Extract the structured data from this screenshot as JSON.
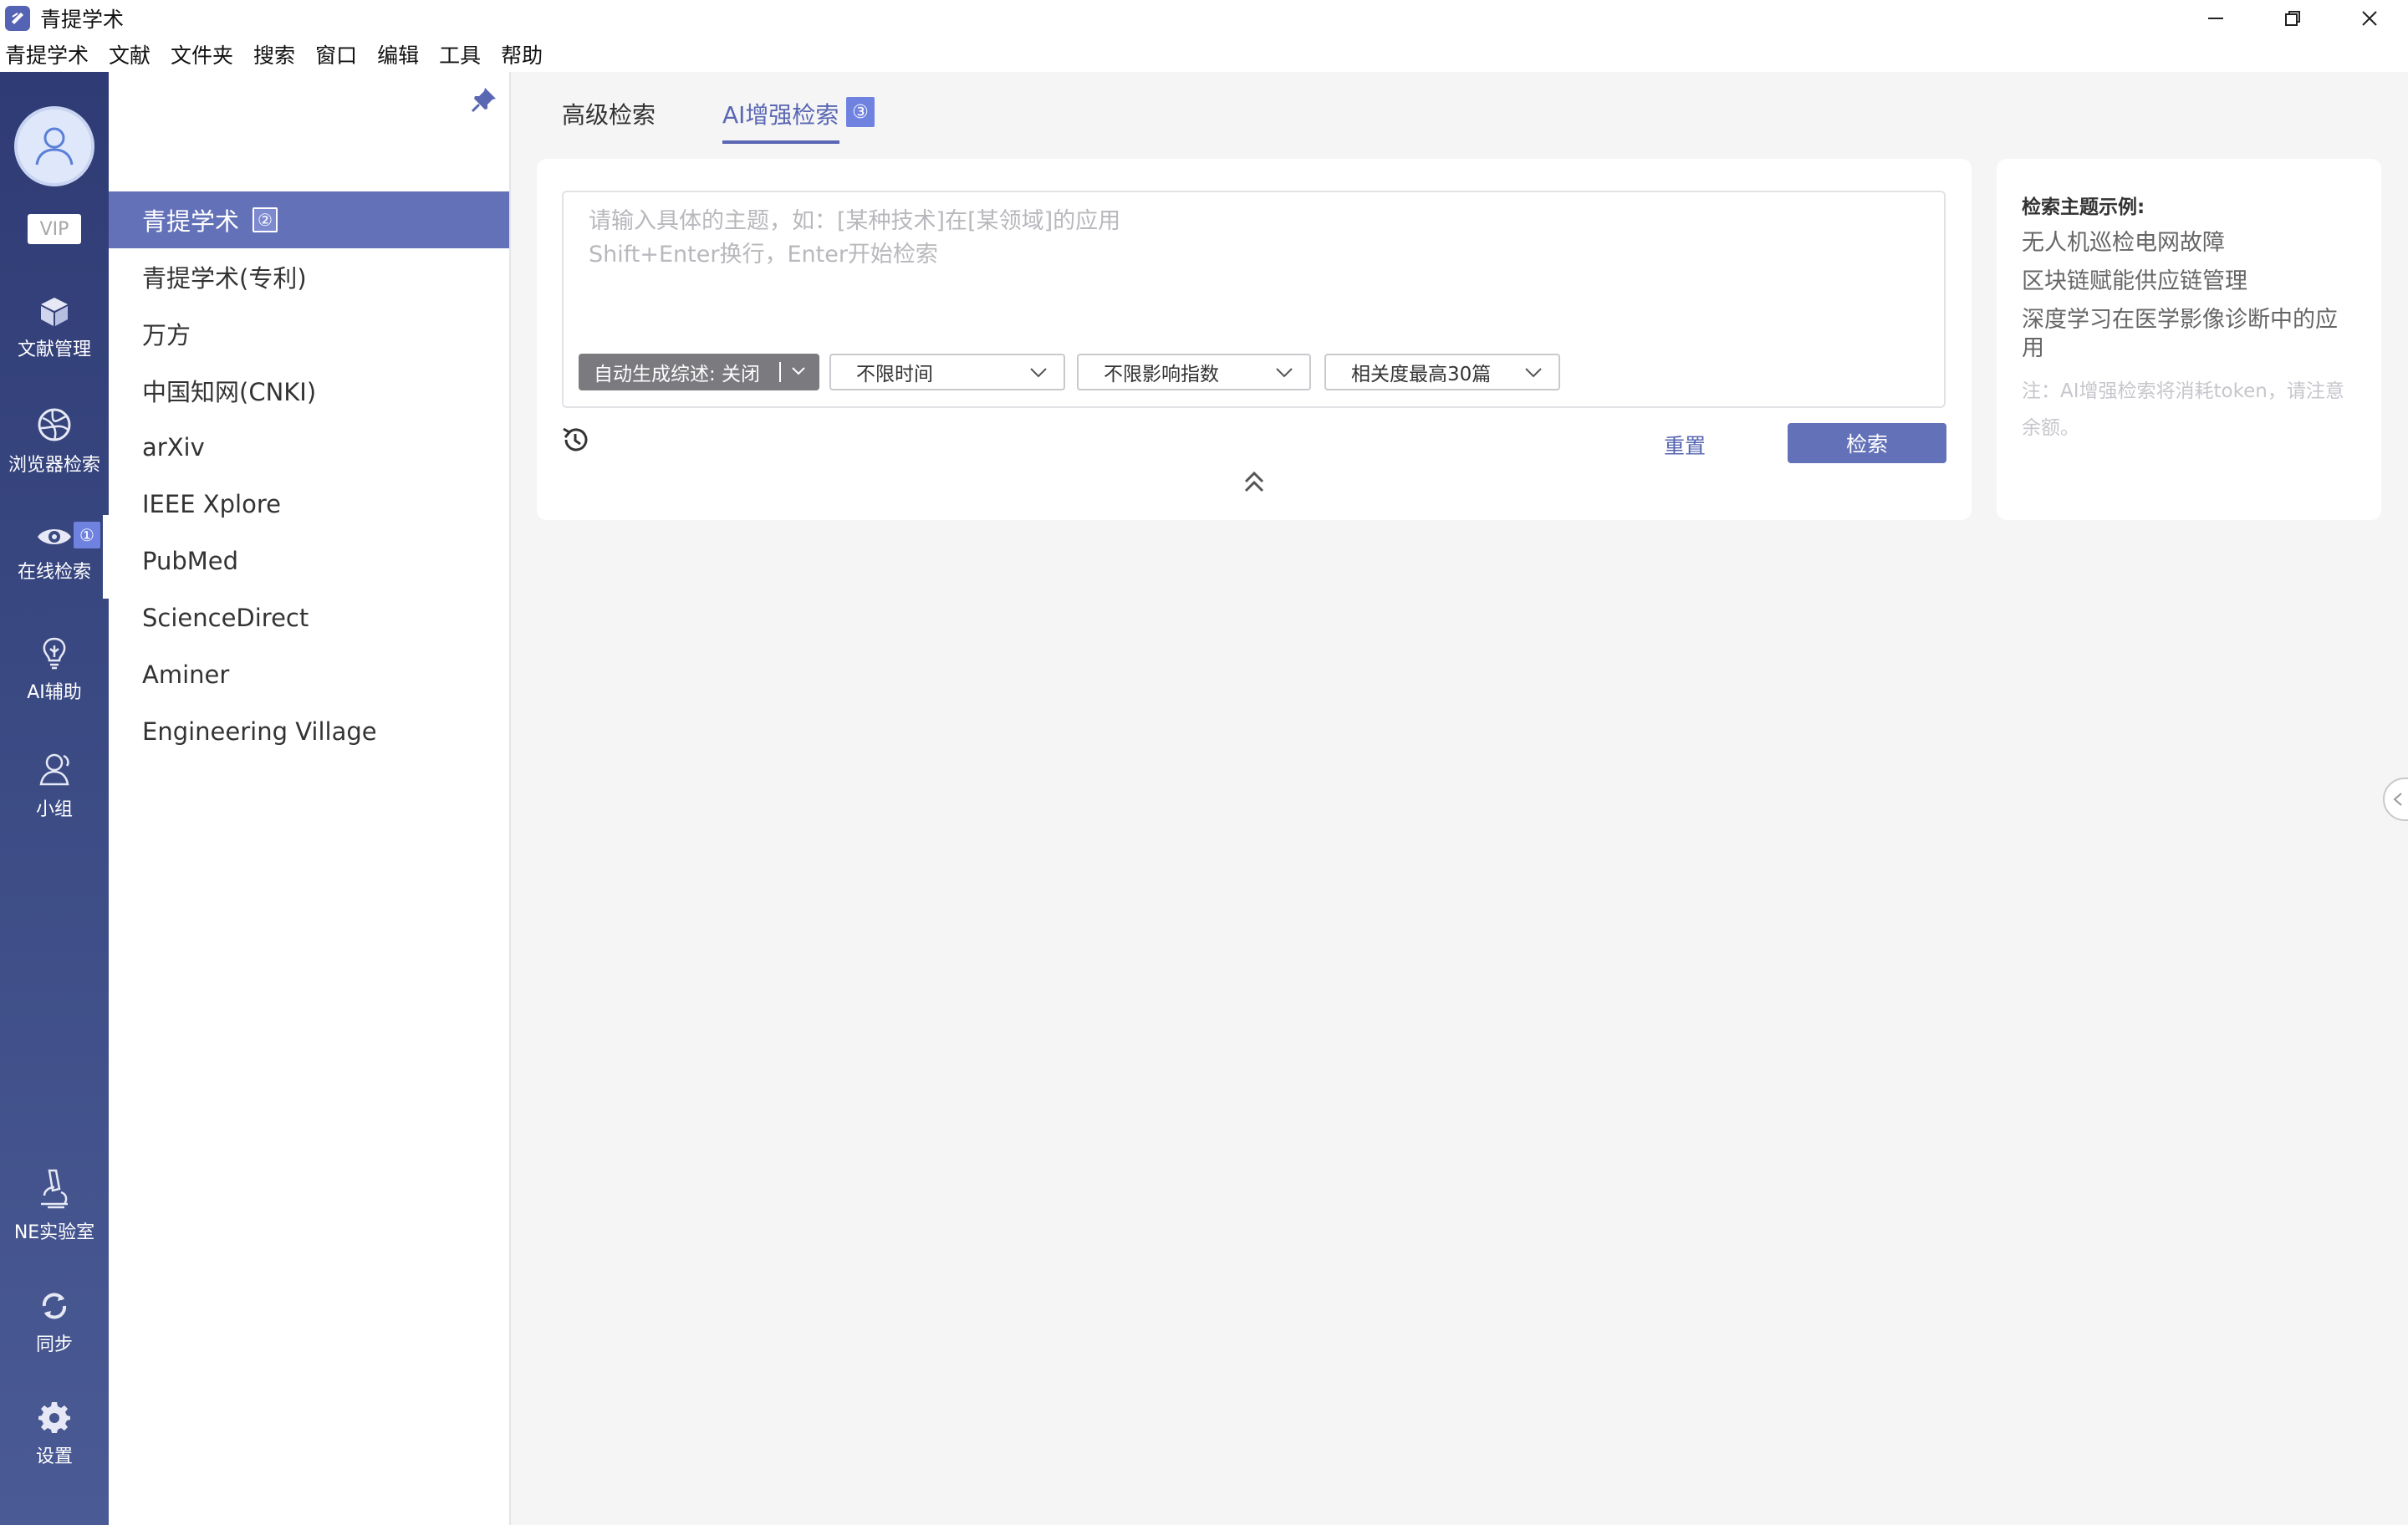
{
  "window": {
    "title": "青提学术"
  },
  "menu": [
    "青提学术",
    "文献",
    "文件夹",
    "搜索",
    "窗口",
    "编辑",
    "工具",
    "帮助"
  ],
  "user": {
    "vip_label": "VIP"
  },
  "leftnav": {
    "items": [
      {
        "label": "文献管理",
        "icon": "box-icon"
      },
      {
        "label": "浏览器检索",
        "icon": "globe-icon"
      },
      {
        "label": "在线检索",
        "icon": "eye-icon",
        "badge": "①",
        "active": true
      },
      {
        "label": "AI辅助",
        "icon": "bulb-icon"
      },
      {
        "label": "小组",
        "icon": "group-icon"
      }
    ],
    "bottom_items": [
      {
        "label": "NE实验室",
        "icon": "microscope-icon"
      },
      {
        "label": "同步",
        "icon": "sync-icon"
      },
      {
        "label": "设置",
        "icon": "gear-icon"
      }
    ]
  },
  "sources": {
    "items": [
      {
        "label": "青提学术",
        "badge": "②",
        "active": true
      },
      {
        "label": "青提学术(专利)"
      },
      {
        "label": "万方"
      },
      {
        "label": "中国知网(CNKI)"
      },
      {
        "label": "arXiv"
      },
      {
        "label": "IEEE Xplore"
      },
      {
        "label": "PubMed"
      },
      {
        "label": "ScienceDirect"
      },
      {
        "label": "Aminer"
      },
      {
        "label": "Engineering Village"
      }
    ]
  },
  "tabs": [
    {
      "label": "高级检索",
      "active": false
    },
    {
      "label": "AI增强检索",
      "active": true,
      "badge": "③"
    }
  ],
  "search": {
    "placeholder_line1": "请输入具体的主题，如：[某种技术]在[某领域]的应用",
    "placeholder_line2": "Shift+Enter换行，Enter开始检索",
    "auto_summary": "自动生成综述: 关闭",
    "time_filter": "不限时间",
    "impact_filter": "不限影响指数",
    "relevance_filter": "相关度最高30篇",
    "reset_label": "重置",
    "search_label": "检索"
  },
  "examples": {
    "title": "检索主题示例:",
    "items": [
      "无人机巡检电网故障",
      "区块链赋能供应链管理",
      "深度学习在医学影像诊断中的应用"
    ],
    "note": "注：AI增强检索将消耗token，请注意余额。"
  },
  "colors": {
    "accent": "#6371b8",
    "nav_bg": "#2f3b74",
    "badge": "#6f82e0"
  }
}
